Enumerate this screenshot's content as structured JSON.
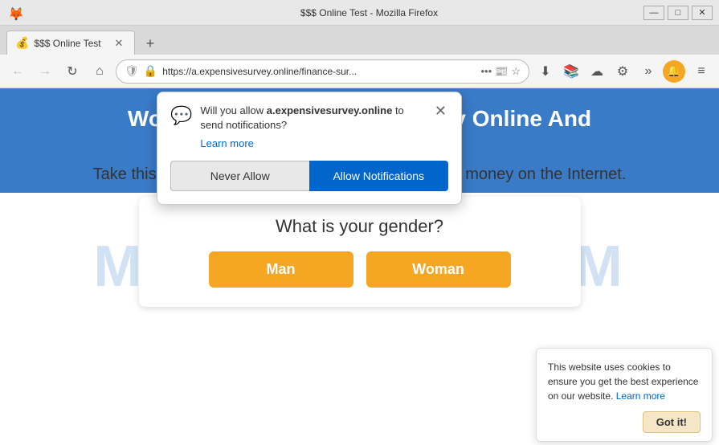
{
  "titleBar": {
    "title": "$$$ Online Test - Mozilla Firefox",
    "iconSymbol": "🦊"
  },
  "windowControls": {
    "minimize": "—",
    "maximize": "□",
    "close": "✕"
  },
  "tab": {
    "favicon": "💰",
    "label": "$$$ Online Test",
    "closeIcon": "✕"
  },
  "tabNew": "+",
  "navBar": {
    "back": "←",
    "forward": "→",
    "reload": "↻",
    "home": "⌂",
    "url": "https://a.expensivesurvey.online/finance-sur...",
    "urlFull": "https://a.expensivesurvey.online/finance-su",
    "securityIcon": "🔒",
    "shieldIcon": "🛡",
    "moreIcon": "•••",
    "bookmarkIcon": "☆",
    "downloadIcon": "⬇",
    "libraryIcon": "📚",
    "syncIcon": "☁",
    "settingsIcon": "⚙",
    "menuIcon": "≡",
    "notificationBell": "🔔"
  },
  "page": {
    "headline": "Wou... nline And",
    "subheadline": "Take this FREE test and find out how you can make money on the Internet.",
    "watermark": "MYANTIVIR...COM",
    "gender": {
      "question": "What is your gender?",
      "manLabel": "Man",
      "womanLabel": "Woman"
    }
  },
  "notificationPopup": {
    "iconSymbol": "💬",
    "titlePart1": "Will you allow ",
    "domain": "a.expensivesurvey.online",
    "titlePart2": " to send notifications?",
    "learnMore": "Learn more",
    "closeIcon": "✕",
    "neverAllow": "Never Allow",
    "allowNotifications": "Allow Notifications"
  },
  "cookieNotice": {
    "text": "This website uses cookies to ensure you get the best experience on our website.",
    "learnMore": "Learn more",
    "gotIt": "Got it!"
  }
}
